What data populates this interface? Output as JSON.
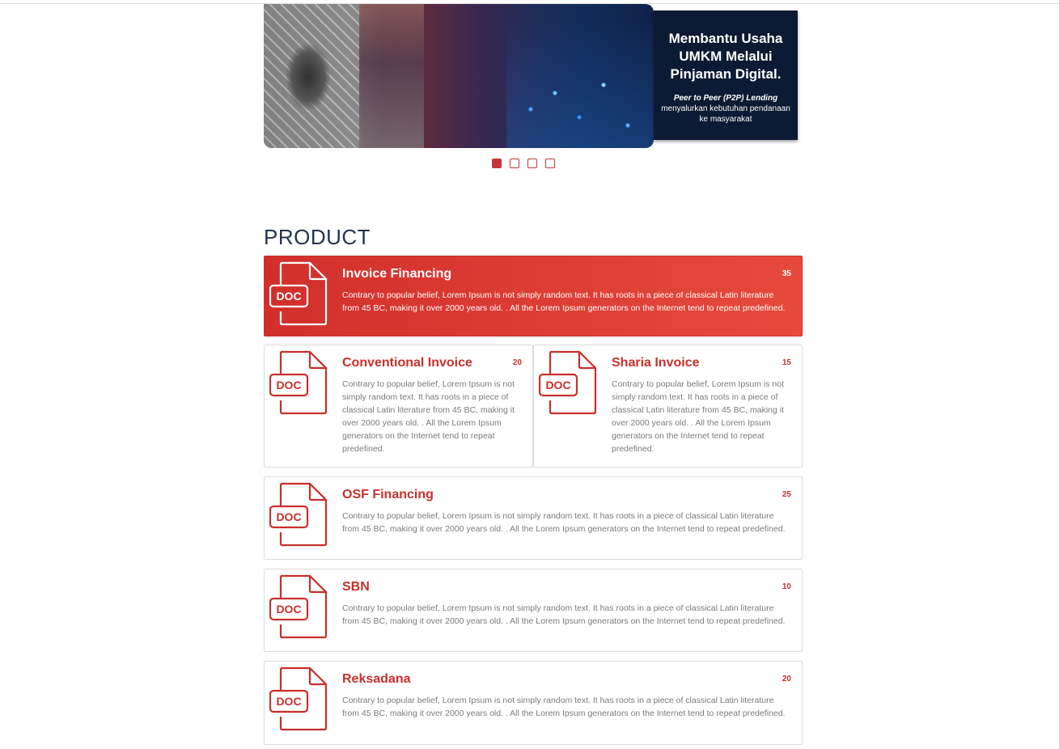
{
  "banner": {
    "headline": "Membantu Usaha\nUMKM Melalui\nPinjaman Digital.",
    "sub_title": "Peer to Peer (P2P) Lending",
    "sub_text": "menyalurkan kebutuhan pendanaan\nke masyarakat",
    "dots_total": 4,
    "active_dot": 1
  },
  "section": {
    "title": "PRODUCT"
  },
  "icon_label": "DOC",
  "colors": {
    "accent": "#c8302c",
    "title": "#24344f",
    "featured_gradient_start": "#d22f2c",
    "featured_gradient_end": "#e64a3b"
  },
  "products": [
    {
      "title": "Invoice Financing",
      "count": "35",
      "desc": "Contrary to popular belief, Lorem Ipsum is not simply random text. It has roots in a piece of classical Latin literature from 45 BC, making it over 2000 years old. . All the Lorem Ipsum generators on the Internet tend to repeat predefined.",
      "icon": "doc-file-icon"
    },
    {
      "title": "Conventional Invoice",
      "count": "20",
      "desc": "Contrary to popular belief, Lorem Ipsum is not simply random text. It has roots in a piece of classical Latin literature from 45 BC, making it over 2000 years old. . All the Lorem Ipsum generators on the Internet tend to repeat predefined.",
      "icon": "doc-file-icon"
    },
    {
      "title": "Sharia Invoice",
      "count": "15",
      "desc": "Contrary to popular belief, Lorem Ipsum is not simply random text. It has roots in a piece of classical Latin literature from 45 BC, making it over 2000 years old. . All the Lorem Ipsum generators on the Internet tend to repeat predefined.",
      "icon": "doc-file-icon"
    },
    {
      "title": "OSF Financing",
      "count": "25",
      "desc": "Contrary to popular belief, Lorem Ipsum is not simply random text. It has roots in a piece of classical Latin literature from 45 BC, making it over 2000 years old. . All the Lorem Ipsum generators on the Internet tend to repeat predefined.",
      "icon": "doc-file-icon"
    },
    {
      "title": "SBN",
      "count": "10",
      "desc": "Contrary to popular belief, Lorem Ipsum is not simply random text. It has roots in a piece of classical Latin literature from 45 BC, making it over 2000 years old. . All the Lorem Ipsum generators on the Internet tend to repeat predefined.",
      "icon": "doc-file-icon"
    },
    {
      "title": "Reksadana",
      "count": "20",
      "desc": "Contrary to popular belief, Lorem Ipsum is not simply random text. It has roots in a piece of classical Latin literature from 45 BC, making it over 2000 years old. . All the Lorem Ipsum generators on the Internet tend to repeat predefined.",
      "icon": "doc-file-icon"
    }
  ]
}
